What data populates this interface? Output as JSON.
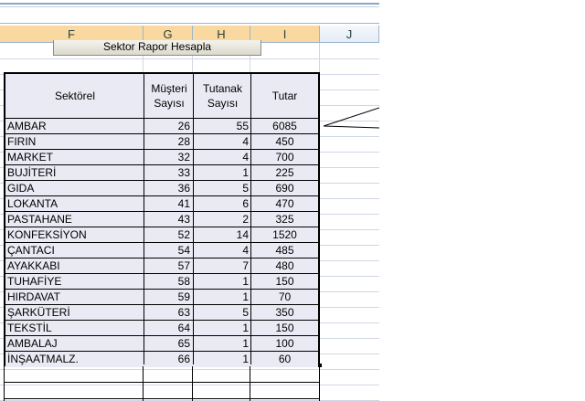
{
  "sheet": {
    "columns": [
      {
        "id": "F",
        "selected": true
      },
      {
        "id": "G",
        "selected": true
      },
      {
        "id": "H",
        "selected": true
      },
      {
        "id": "I",
        "selected": true
      },
      {
        "id": "J",
        "selected": false
      }
    ],
    "button_label": "Sektor Rapor Hesapla"
  },
  "table": {
    "headers": [
      "Sektörel",
      "Müşteri\nSayısı",
      "Tutanak\nSayısı",
      "Tutar"
    ],
    "rows": [
      {
        "sektor": "AMBAR",
        "musteri": "26",
        "tutanak": "55",
        "tutar": "6085"
      },
      {
        "sektor": "FIRIN",
        "musteri": "28",
        "tutanak": "4",
        "tutar": "450"
      },
      {
        "sektor": "MARKET",
        "musteri": "32",
        "tutanak": "4",
        "tutar": "700"
      },
      {
        "sektor": "BUJİTERİ",
        "musteri": "33",
        "tutanak": "1",
        "tutar": "225"
      },
      {
        "sektor": "GIDA",
        "musteri": "36",
        "tutanak": "5",
        "tutar": "690"
      },
      {
        "sektor": "LOKANTA",
        "musteri": "41",
        "tutanak": "6",
        "tutar": "470"
      },
      {
        "sektor": "PASTAHANE",
        "musteri": "43",
        "tutanak": "2",
        "tutar": "325"
      },
      {
        "sektor": "KONFEKSİYON",
        "musteri": "52",
        "tutanak": "14",
        "tutar": "1520"
      },
      {
        "sektor": "ÇANTACI",
        "musteri": "54",
        "tutanak": "4",
        "tutar": "485"
      },
      {
        "sektor": "AYAKKABI",
        "musteri": "57",
        "tutanak": "7",
        "tutar": "480"
      },
      {
        "sektor": "TUHAFİYE",
        "musteri": "58",
        "tutanak": "1",
        "tutar": "150"
      },
      {
        "sektor": "HIRDAVAT",
        "musteri": "59",
        "tutanak": "1",
        "tutar": "70"
      },
      {
        "sektor": "ŞARKÜTERİ",
        "musteri": "63",
        "tutanak": "5",
        "tutar": "350"
      },
      {
        "sektor": "TEKSTİL",
        "musteri": "64",
        "tutanak": "1",
        "tutar": "150"
      },
      {
        "sektor": "AMBALAJ",
        "musteri": "65",
        "tutanak": "1",
        "tutar": "100"
      },
      {
        "sektor": "İNŞAATMALZ.",
        "musteri": "66",
        "tutanak": "1",
        "tutar": "60"
      }
    ]
  }
}
